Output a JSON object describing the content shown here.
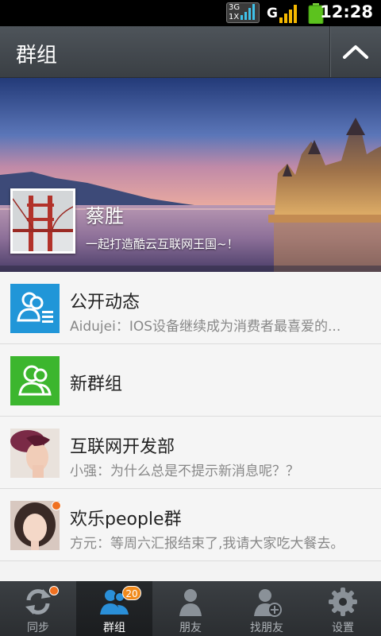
{
  "status": {
    "network_top": "3G",
    "network_bottom": "1X",
    "signal_type": "G",
    "time": "12:28"
  },
  "header": {
    "title": "群组",
    "collapse_icon": "chevron-up-icon"
  },
  "profile": {
    "name": "蔡胜",
    "motto": "一起打造酷云互联网王国~！"
  },
  "groups": [
    {
      "name": "公开动态",
      "subtitle": "Aidujei：IOS设备继续成为消费者最喜爱的...",
      "icon": "public-feed-icon",
      "color": "#2196d8"
    },
    {
      "name": "新群组",
      "subtitle": "",
      "icon": "new-group-icon",
      "color": "#3cb62e"
    },
    {
      "name": "互联网开发部",
      "subtitle": "小强：为什么总是不提示新消息呢？？",
      "icon": "group-avatar"
    },
    {
      "name": "欢乐people群",
      "subtitle": "方元：等周六汇报结束了,我请大家吃大餐去。",
      "icon": "group-avatar",
      "unread": true
    }
  ],
  "tabs": [
    {
      "label": "同步",
      "icon": "sync-icon",
      "dot": true
    },
    {
      "label": "群组",
      "icon": "groups-icon",
      "badge": "20",
      "active": true
    },
    {
      "label": "朋友",
      "icon": "friend-icon"
    },
    {
      "label": "找朋友",
      "icon": "find-friend-icon"
    },
    {
      "label": "设置",
      "icon": "settings-icon"
    }
  ]
}
